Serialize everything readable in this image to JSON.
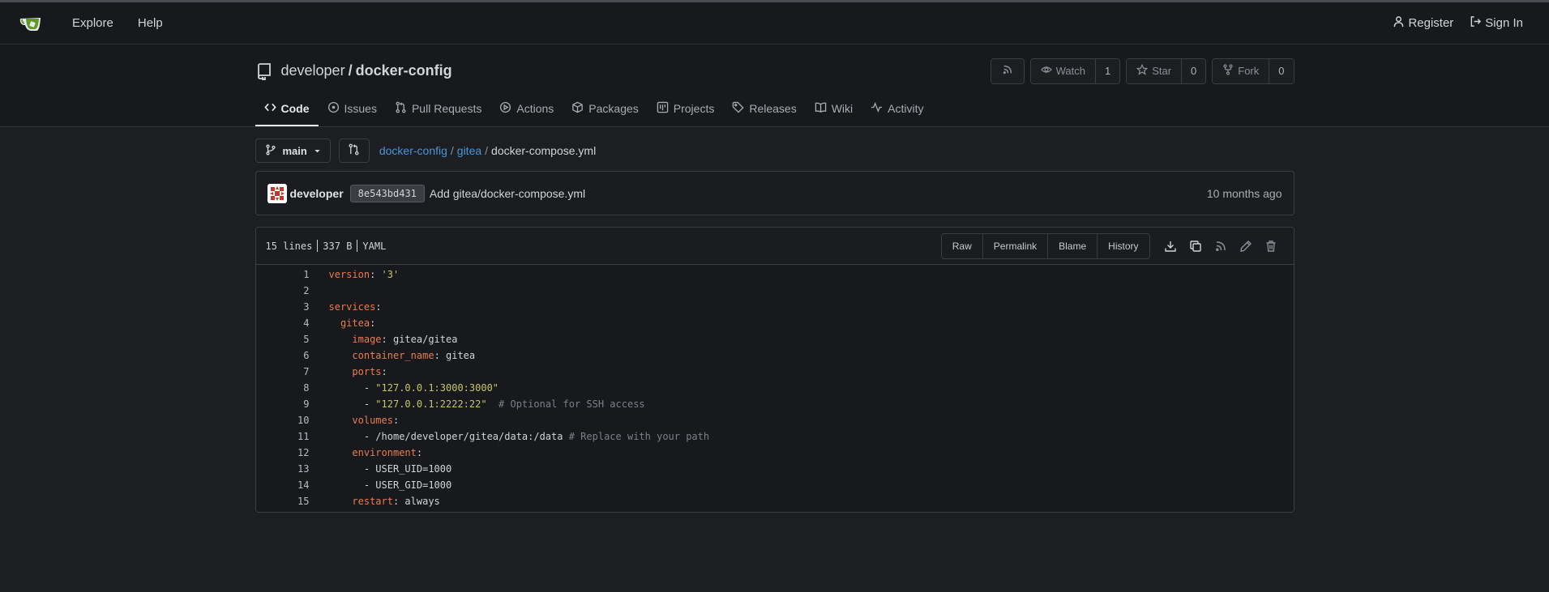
{
  "nav": {
    "explore": "Explore",
    "help": "Help",
    "register": "Register",
    "sign_in": "Sign In"
  },
  "repo": {
    "owner": "developer",
    "separator": "/",
    "name": "docker-config",
    "watch_label": "Watch",
    "watch_count": "1",
    "star_label": "Star",
    "star_count": "0",
    "fork_label": "Fork",
    "fork_count": "0"
  },
  "tabs": [
    "Code",
    "Issues",
    "Pull Requests",
    "Actions",
    "Packages",
    "Projects",
    "Releases",
    "Wiki",
    "Activity"
  ],
  "branch": {
    "name": "main",
    "breadcrumb": [
      "docker-config",
      "gitea",
      "docker-compose.yml"
    ]
  },
  "commit": {
    "author": "developer",
    "sha": "8e543bd431",
    "message": "Add gitea/docker-compose.yml",
    "time": "10 months ago"
  },
  "file": {
    "lines": "15 lines",
    "size": "337 B",
    "type": "YAML",
    "actions": [
      "Raw",
      "Permalink",
      "Blame",
      "History"
    ]
  },
  "code": [
    {
      "n": "1",
      "text": "version: '3'"
    },
    {
      "n": "2",
      "text": ""
    },
    {
      "n": "3",
      "text": "services:"
    },
    {
      "n": "4",
      "text": "  gitea:"
    },
    {
      "n": "5",
      "text": "    image: gitea/gitea"
    },
    {
      "n": "6",
      "text": "    container_name: gitea"
    },
    {
      "n": "7",
      "text": "    ports:"
    },
    {
      "n": "8",
      "text": "      - \"127.0.0.1:3000:3000\""
    },
    {
      "n": "9",
      "text": "      - \"127.0.0.1:2222:22\"  # Optional for SSH access"
    },
    {
      "n": "10",
      "text": "    volumes:"
    },
    {
      "n": "11",
      "text": "      - /home/developer/gitea/data:/data # Replace with your path"
    },
    {
      "n": "12",
      "text": "    environment:"
    },
    {
      "n": "13",
      "text": "      - USER_UID=1000"
    },
    {
      "n": "14",
      "text": "      - USER_GID=1000"
    },
    {
      "n": "15",
      "text": "    restart: always"
    }
  ]
}
